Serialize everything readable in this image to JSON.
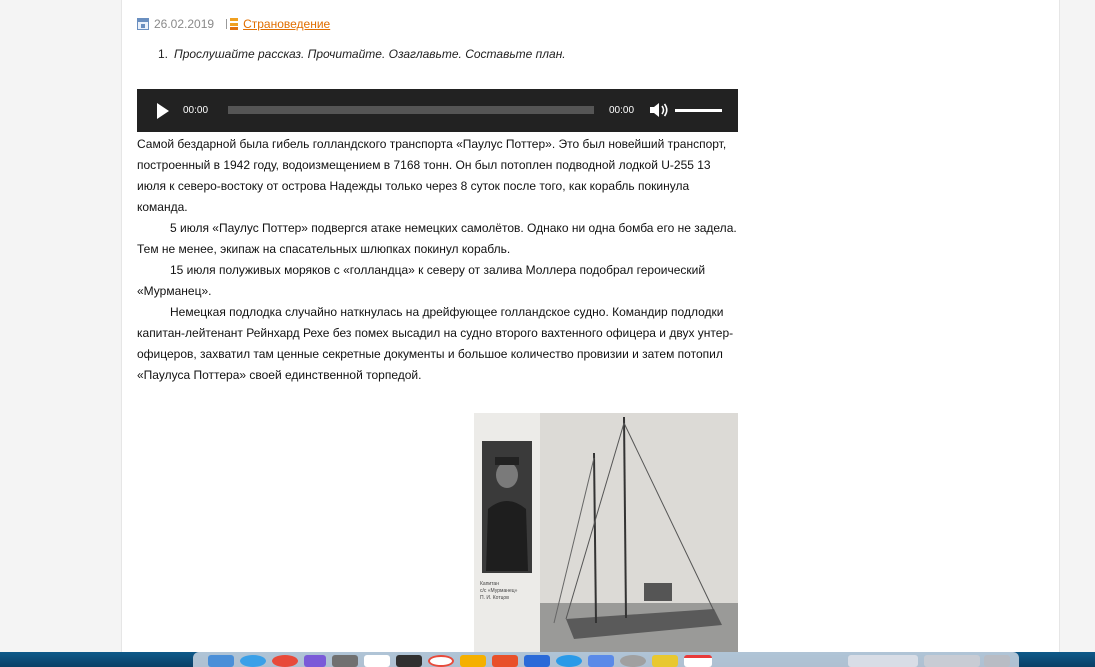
{
  "meta": {
    "date": "26.02.2019",
    "category": "Страноведение"
  },
  "task": {
    "number": "1.",
    "text": "Прослушайте рассказ. Прочитайте. Озаглавьте. Составьте план."
  },
  "player": {
    "current_time": "00:00",
    "duration": "00:00",
    "progress": 0,
    "volume": 1
  },
  "article": {
    "paragraphs": [
      "Самой бездарной была гибель голландского транспорта «Паулус Поттер». Это был новейший транспорт, построенный в 1942 году, водоизмещением в 7168 тонн. Он был потоплен подводной лодкой U-255 13 июля к северо-востоку от острова Надежды только через 8 суток после того, как корабль покинула команда.",
      "5 июля «Паулус Поттер» подвергся атаке немецких самолётов. Однако ни одна бомба его не задела. Тем не менее, экипаж на спасательных шлюпках покинул корабль.",
      "15 июля полуживых моряков с «голландца» к северу от залива Моллера подобрал героический «Мурманец».",
      "Немецкая подлодка случайно наткнулась на дрейфующее голландское судно. Командир подлодки капитан-лейтенант Рейнхард Рехе без помех высадил на судно второго вахтенного офицера и двух унтер-офицеров, захватил там ценные секретные документы и большое количество провизии и затем потопил «Паулуса Поттера» своей единственной торпедой."
    ]
  },
  "photo": {
    "caption_lines": [
      "Капитан",
      "с/с «Мурманец»",
      "П. И. Котцов"
    ]
  },
  "colors": {
    "link": "#e06e00",
    "player_bg": "#222222",
    "dock": "#0a3f66"
  }
}
